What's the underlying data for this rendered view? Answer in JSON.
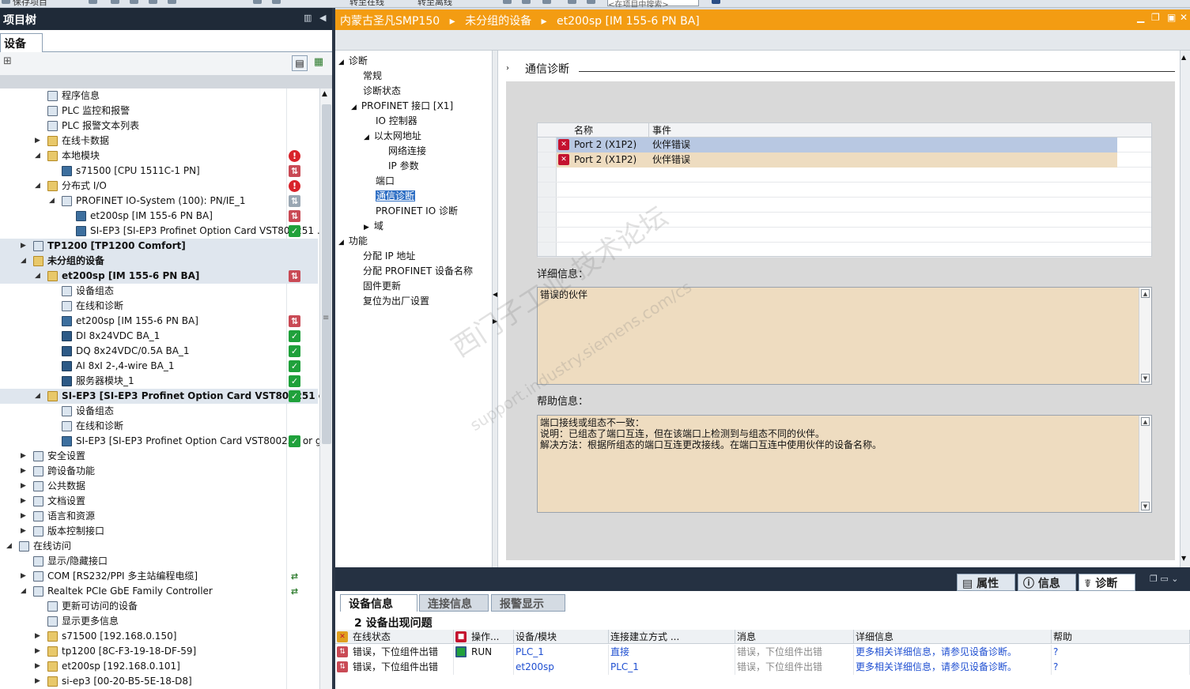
{
  "toolbar": {
    "save_label": "保存项目",
    "goto_online": "转至在线",
    "goto_offline": "转至离线",
    "search_placeholder": "<在项目中搜索>"
  },
  "left_panel": {
    "title": "项目树",
    "tab": "设备",
    "tree": [
      {
        "label": "程序信息",
        "indent": 2,
        "icon": "program-info-icon",
        "exp": "",
        "status": ""
      },
      {
        "label": "PLC 监控和报警",
        "indent": 2,
        "icon": "plc-monitor-icon",
        "exp": "",
        "status": ""
      },
      {
        "label": "PLC 报警文本列表",
        "indent": 2,
        "icon": "alarm-text-icon",
        "exp": "",
        "status": ""
      },
      {
        "label": "在线卡数据",
        "indent": 2,
        "icon": "folder-icon",
        "exp": "▶",
        "status": ""
      },
      {
        "label": "本地模块",
        "indent": 2,
        "icon": "folder-icon",
        "exp": "◢",
        "status": "err"
      },
      {
        "label": "s71500 [CPU 1511C-1 PN]",
        "indent": 3,
        "icon": "cpu-icon",
        "exp": "",
        "status": "dl"
      },
      {
        "label": "分布式 I/O",
        "indent": 2,
        "icon": "folder-icon",
        "exp": "◢",
        "status": "err"
      },
      {
        "label": "PROFINET IO-System (100): PN/IE_1",
        "indent": 3,
        "icon": "network-icon",
        "exp": "◢",
        "status": "gr"
      },
      {
        "label": "et200sp [IM 155-6 PN BA]",
        "indent": 4,
        "icon": "device-icon",
        "exp": "",
        "status": "dl"
      },
      {
        "label": "SI-EP3 [SI-EP3 Profinet Option Card VST800251 ...",
        "indent": 4,
        "icon": "device-icon",
        "exp": "",
        "status": "ok"
      },
      {
        "label": "TP1200 [TP1200 Comfort]",
        "indent": 1,
        "icon": "hmi-icon",
        "exp": "▶",
        "status": "",
        "bold": true
      },
      {
        "label": "未分组的设备",
        "indent": 1,
        "icon": "folder-icon",
        "exp": "◢",
        "status": "",
        "bold": true
      },
      {
        "label": "et200sp [IM 155-6 PN BA]",
        "indent": 2,
        "icon": "folder-icon",
        "exp": "◢",
        "status": "dl",
        "bold": true
      },
      {
        "label": "设备组态",
        "indent": 3,
        "icon": "device-config-icon",
        "exp": "",
        "status": ""
      },
      {
        "label": "在线和诊断",
        "indent": 3,
        "icon": "online-diag-icon",
        "exp": "",
        "status": ""
      },
      {
        "label": "et200sp [IM 155-6 PN BA]",
        "indent": 3,
        "icon": "device-icon",
        "exp": "",
        "status": "dl"
      },
      {
        "label": "DI 8x24VDC BA_1",
        "indent": 3,
        "icon": "module-icon",
        "exp": "",
        "status": "ok"
      },
      {
        "label": "DQ 8x24VDC/0.5A BA_1",
        "indent": 3,
        "icon": "module-icon",
        "exp": "",
        "status": "ok"
      },
      {
        "label": "AI 8xI 2-,4-wire BA_1",
        "indent": 3,
        "icon": "module-icon",
        "exp": "",
        "status": "ok"
      },
      {
        "label": "服务器模块_1",
        "indent": 3,
        "icon": "module-icon",
        "exp": "",
        "status": "ok"
      },
      {
        "label": "SI-EP3 [SI-EP3 Profinet Option Card VST800251 or ...",
        "indent": 2,
        "icon": "folder-icon",
        "exp": "◢",
        "status": "ok",
        "bold": true
      },
      {
        "label": "设备组态",
        "indent": 3,
        "icon": "device-config-icon",
        "exp": "",
        "status": ""
      },
      {
        "label": "在线和诊断",
        "indent": 3,
        "icon": "online-diag-icon",
        "exp": "",
        "status": ""
      },
      {
        "label": "SI-EP3 [SI-EP3 Profinet Option Card VST800251 or g...",
        "indent": 3,
        "icon": "device-icon",
        "exp": "",
        "status": "ok"
      },
      {
        "label": "安全设置",
        "indent": 1,
        "icon": "security-icon",
        "exp": "▶",
        "status": ""
      },
      {
        "label": "跨设备功能",
        "indent": 1,
        "icon": "cross-device-icon",
        "exp": "▶",
        "status": ""
      },
      {
        "label": "公共数据",
        "indent": 1,
        "icon": "common-data-icon",
        "exp": "▶",
        "status": ""
      },
      {
        "label": "文档设置",
        "indent": 1,
        "icon": "doc-settings-icon",
        "exp": "▶",
        "status": ""
      },
      {
        "label": "语言和资源",
        "indent": 1,
        "icon": "language-icon",
        "exp": "▶",
        "status": ""
      },
      {
        "label": "版本控制接口",
        "indent": 1,
        "icon": "version-control-icon",
        "exp": "▶",
        "status": ""
      },
      {
        "label": "在线访问",
        "indent": 0,
        "icon": "online-access-icon",
        "exp": "◢",
        "status": ""
      },
      {
        "label": "显示/隐藏接口",
        "indent": 1,
        "icon": "show-hide-icon",
        "exp": "",
        "status": ""
      },
      {
        "label": "COM [RS232/PPI 多主站编程电缆]",
        "indent": 1,
        "icon": "interface-icon",
        "exp": "▶",
        "status": "net"
      },
      {
        "label": "Realtek PCIe GbE Family Controller",
        "indent": 1,
        "icon": "interface-icon",
        "exp": "◢",
        "status": "net"
      },
      {
        "label": "更新可访问的设备",
        "indent": 2,
        "icon": "update-icon",
        "exp": "",
        "status": ""
      },
      {
        "label": "显示更多信息",
        "indent": 2,
        "icon": "info-icon",
        "exp": "",
        "status": ""
      },
      {
        "label": "s71500 [192.168.0.150]",
        "indent": 2,
        "icon": "folder-icon",
        "exp": "▶",
        "status": ""
      },
      {
        "label": "tp1200 [8C-F3-19-18-DF-59]",
        "indent": 2,
        "icon": "folder-icon",
        "exp": "▶",
        "status": ""
      },
      {
        "label": "et200sp [192.168.0.101]",
        "indent": 2,
        "icon": "folder-icon",
        "exp": "▶",
        "status": ""
      },
      {
        "label": "si-ep3 [00-20-B5-5E-18-D8]",
        "indent": 2,
        "icon": "folder-icon",
        "exp": "▶",
        "status": ""
      }
    ]
  },
  "editor": {
    "breadcrumb": [
      "内蒙古圣凡SMP150",
      "未分组的设备",
      "et200sp [IM 155-6 PN BA]"
    ],
    "nav": [
      {
        "label": "诊断",
        "indent": 0,
        "exp": "◢"
      },
      {
        "label": "常规",
        "indent": 1,
        "exp": ""
      },
      {
        "label": "诊断状态",
        "indent": 1,
        "exp": ""
      },
      {
        "label": "PROFINET 接口 [X1]",
        "indent": 1,
        "exp": "◢"
      },
      {
        "label": "IO 控制器",
        "indent": 2,
        "exp": ""
      },
      {
        "label": "以太网地址",
        "indent": 2,
        "exp": "◢"
      },
      {
        "label": "网络连接",
        "indent": 3,
        "exp": ""
      },
      {
        "label": "IP 参数",
        "indent": 3,
        "exp": ""
      },
      {
        "label": "端口",
        "indent": 2,
        "exp": ""
      },
      {
        "label": "通信诊断",
        "indent": 2,
        "exp": "",
        "active": true
      },
      {
        "label": "PROFINET IO 诊断",
        "indent": 2,
        "exp": ""
      },
      {
        "label": "域",
        "indent": 2,
        "exp": "▶"
      },
      {
        "label": "功能",
        "indent": 0,
        "exp": "◢"
      },
      {
        "label": "分配 IP 地址",
        "indent": 1,
        "exp": ""
      },
      {
        "label": "分配 PROFINET 设备名称",
        "indent": 1,
        "exp": ""
      },
      {
        "label": "固件更新",
        "indent": 1,
        "exp": ""
      },
      {
        "label": "复位为出厂设置",
        "indent": 1,
        "exp": ""
      }
    ],
    "section_title": "通信诊断",
    "table": {
      "headers": [
        "名称",
        "事件"
      ],
      "rows": [
        {
          "name": "Port 2 (X1P2)",
          "event": "伙伴错误",
          "bg": "#b8c8e2"
        },
        {
          "name": "Port 2 (X1P2)",
          "event": "伙伴错误",
          "bg": "#eedcc0"
        }
      ]
    },
    "detail_label": "详细信息：",
    "detail_text": "错误的伙伴",
    "help_label": "帮助信息：",
    "help_lines": [
      "端口接线或组态不一致：",
      "说明：已组态了端口互连，但在该端口上检测到与组态不同的伙伴。",
      "解决方法：根据所组态的端口互连更改接线。在端口互连中使用伙伴的设备名称。"
    ],
    "watermark": "西门子工业 技术论坛",
    "watermark_url": "support.industry.siemens.com/cs"
  },
  "inspector": {
    "tabs": [
      "属性",
      "信息",
      "诊断"
    ],
    "subtabs": [
      "设备信息",
      "连接信息",
      "报警显示"
    ],
    "issue_count": "2 设备出现问题",
    "columns": [
      "在线状态",
      "操作...",
      "设备/模块",
      "连接建立方式 ...",
      "消息",
      "详细信息",
      "帮助"
    ],
    "rows": [
      {
        "status": "错误，下位组件出错",
        "op": "RUN",
        "device": "PLC_1",
        "conn": "直接",
        "msg": "错误，下位组件出错",
        "detail": "更多相关详细信息，请参见设备诊断。",
        "help": "?"
      },
      {
        "status": "错误，下位组件出错",
        "op": "",
        "device": "et200sp",
        "conn": "PLC_1",
        "msg": "错误，下位组件出错",
        "detail": "更多相关详细信息，请参见设备诊断。",
        "help": "?"
      }
    ]
  }
}
